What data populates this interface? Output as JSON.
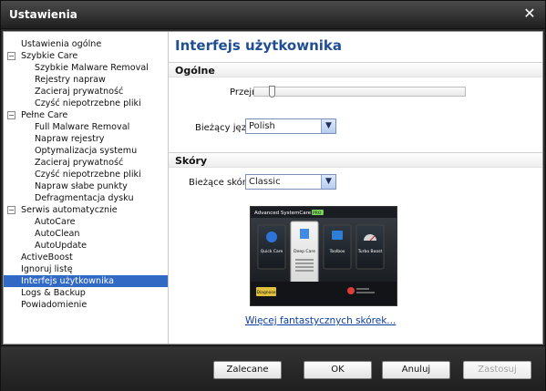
{
  "window": {
    "title": "Ustawienia"
  },
  "sidebar": {
    "items": [
      {
        "label": "Ustawienia ogólne"
      },
      {
        "label": "Szybkie Care"
      },
      {
        "label": "Szybkie Malware Removal"
      },
      {
        "label": "Rejestry napraw"
      },
      {
        "label": "Zacieraj prywatność"
      },
      {
        "label": "Czyść niepotrzebne pliki"
      },
      {
        "label": "Pełne Care"
      },
      {
        "label": "Full Malware Removal"
      },
      {
        "label": "Napraw rejestry"
      },
      {
        "label": "Optymalizacja systemu"
      },
      {
        "label": "Zacieraj prywatność"
      },
      {
        "label": "Czyść niepotrzebne pliki"
      },
      {
        "label": "Napraw słabe punkty"
      },
      {
        "label": "Defragmentacja dysku"
      },
      {
        "label": "Serwis automatycznie"
      },
      {
        "label": "AutoCare"
      },
      {
        "label": "AutoClean"
      },
      {
        "label": "AutoUpdate"
      },
      {
        "label": "ActiveBoost"
      },
      {
        "label": "Ignoruj listę"
      },
      {
        "label": "Interfejs użytkownika"
      },
      {
        "label": "Logs & Backup"
      },
      {
        "label": "Powiadomienie"
      }
    ]
  },
  "main": {
    "heading": "Interfejs użytkownika",
    "general": {
      "title": "Ogólne",
      "transparency_label": "Przejrzystość:",
      "transparency_value": 0.08,
      "language_label": "Bieżący język",
      "language_value": "Polish"
    },
    "skins": {
      "title": "Skóry",
      "current_label": "Bieżące skóry",
      "current_value": "Classic",
      "more_link": "Więcej fantastycznych skórek..."
    },
    "preview": {
      "app_title": "Advanced SystemCare",
      "badge": "PRO 3",
      "tiles": [
        "Quick Care",
        "Deep Care",
        "Toolbox",
        "Turbo Boost"
      ],
      "button": "Diagnose"
    }
  },
  "footer": {
    "buttons": {
      "defaults": "Zalecane",
      "ok": "OK",
      "cancel": "Anuluj",
      "apply": "Zastosuj"
    }
  },
  "colors": {
    "accent": "#316ac5",
    "heading": "#1f4e93",
    "link": "#0b3ea5"
  }
}
